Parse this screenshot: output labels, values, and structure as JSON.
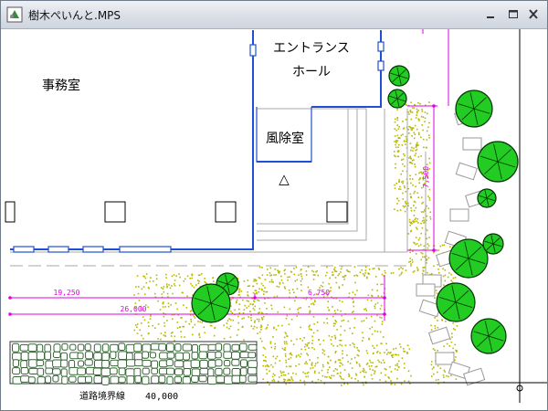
{
  "window": {
    "title": "樹木ぺいんと.MPS",
    "controls": [
      "minimize-icon",
      "maximize-icon",
      "close-icon"
    ]
  },
  "drawing": {
    "rooms": {
      "office": "事務室",
      "entrance_line1": "エントランス",
      "entrance_line2": "ホール",
      "windbreak": "風除室",
      "entry_marker": "△"
    },
    "dimensions": {
      "d1": "19,250",
      "d2": "26,000",
      "d3": "6,750",
      "d4": "7,500"
    },
    "road_label": "道路境界線",
    "road_value": "40,000",
    "colors": {
      "building_wall": "#1f4fd6",
      "dimension": "#e000e0",
      "tree_fill": "#22cc22",
      "tree_stroke": "#003300",
      "ground_dots": "#b8b800",
      "paving": "#336633",
      "gray_outline": "#a8a8a8"
    }
  }
}
